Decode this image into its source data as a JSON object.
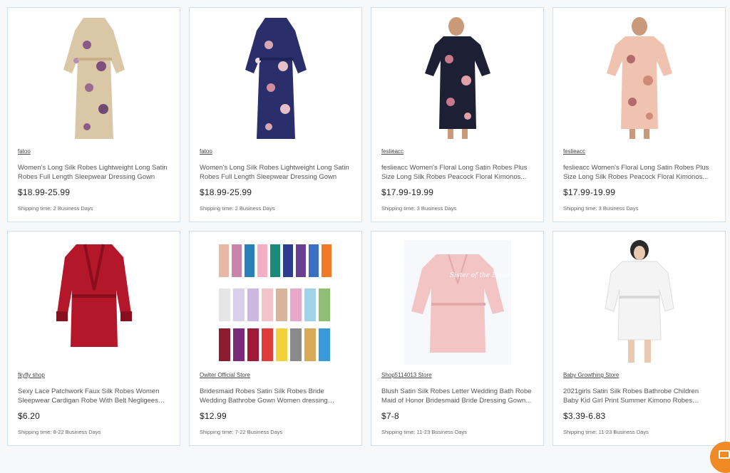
{
  "products": [
    {
      "store": "fatoo",
      "title": "Women's Long Silk Robes Lightweight Long Satin Robes Full Length Sleepwear Dressing Gown",
      "price": "$18.99-25.99",
      "shipping": "Shipping time: 2 Business Days",
      "image": "long-robe-gold-floral",
      "colors": {
        "main": "#d9c7a6",
        "accent": "#7d4f7a"
      }
    },
    {
      "store": "fatoo",
      "title": "Women's Long Silk Robes Lightweight Long Satin Robes Full Length Sleepwear Dressing Gown",
      "price": "$18.99-25.99",
      "shipping": "Shipping time: 2 Business Days",
      "image": "long-robe-navy-floral",
      "colors": {
        "main": "#2a2f6b",
        "accent": "#d9a7b4"
      }
    },
    {
      "store": "feslieacc",
      "title": "feslieacc Women's Floral Long Satin Robes Plus Size Long Silk Robes Peacock Floral Kimonos...",
      "price": "$17.99-19.99",
      "shipping": "Shipping time: 3 Business Days",
      "image": "plus-size-robe-black-floral",
      "colors": {
        "main": "#1d1f35",
        "accent": "#c9788a"
      }
    },
    {
      "store": "feslieacc",
      "title": "feslieacc Women's Floral Long Satin Robes Plus Size Long Silk Robes Peacock Floral Kimonos...",
      "price": "$17.99-19.99",
      "shipping": "Shipping time: 3 Business Days",
      "image": "plus-size-robe-pink-floral",
      "colors": {
        "main": "#f0c3b0",
        "accent": "#b56a6a"
      }
    },
    {
      "store": "fkyfly shop",
      "title": "Sexy Lace Patchwork Faux Silk Robes Women Sleepwear Cardigan Robe With Belt Negligees 7...",
      "price": "$6.20",
      "shipping": "Shipping time: 8-22 Business Days",
      "image": "short-robe-red-lace",
      "colors": {
        "main": "#b4172a",
        "accent": "#8a0f1e"
      }
    },
    {
      "store": "Owlter Official Store",
      "title": "Bridesmaid Robes Satin Silk Robes Bride Wedding Bathrobe Gown Women dressing Sleepwear Maid ...",
      "price": "$12.99",
      "shipping": "Shipping time: 7-22 Business Days",
      "image": "bridesmaid-robes-color-chart",
      "colors": {
        "main": "#cccccc",
        "accent": "#888888"
      }
    },
    {
      "store": "Shop5114013 Store",
      "title": "Blush Satin Silk Robes Letter Wedding Bath Robe Maid of Honor Bridesmaid Bride Dressing Gown...",
      "price": "$7-8",
      "shipping": "Shipping time: 11-23 Business Days",
      "image": "blush-bride-robe",
      "colors": {
        "main": "#f2c4c4",
        "accent": "#ffffff"
      },
      "image_text": "Sister of the Bride"
    },
    {
      "store": "Baby Growthing Store",
      "title": "2021girls Satin Silk Robes Bathrobe Children Baby Kid Girl Print Summer Kimono Robes Bathrobe...",
      "price": "$3.39-6.83",
      "shipping": "Shipping time: 11-23 Business Days",
      "image": "white-satin-robe",
      "colors": {
        "main": "#f4f4f4",
        "accent": "#d8d8d8"
      }
    }
  ],
  "chat_button": {
    "icon": "chat-icon",
    "color": "#f08a24"
  }
}
